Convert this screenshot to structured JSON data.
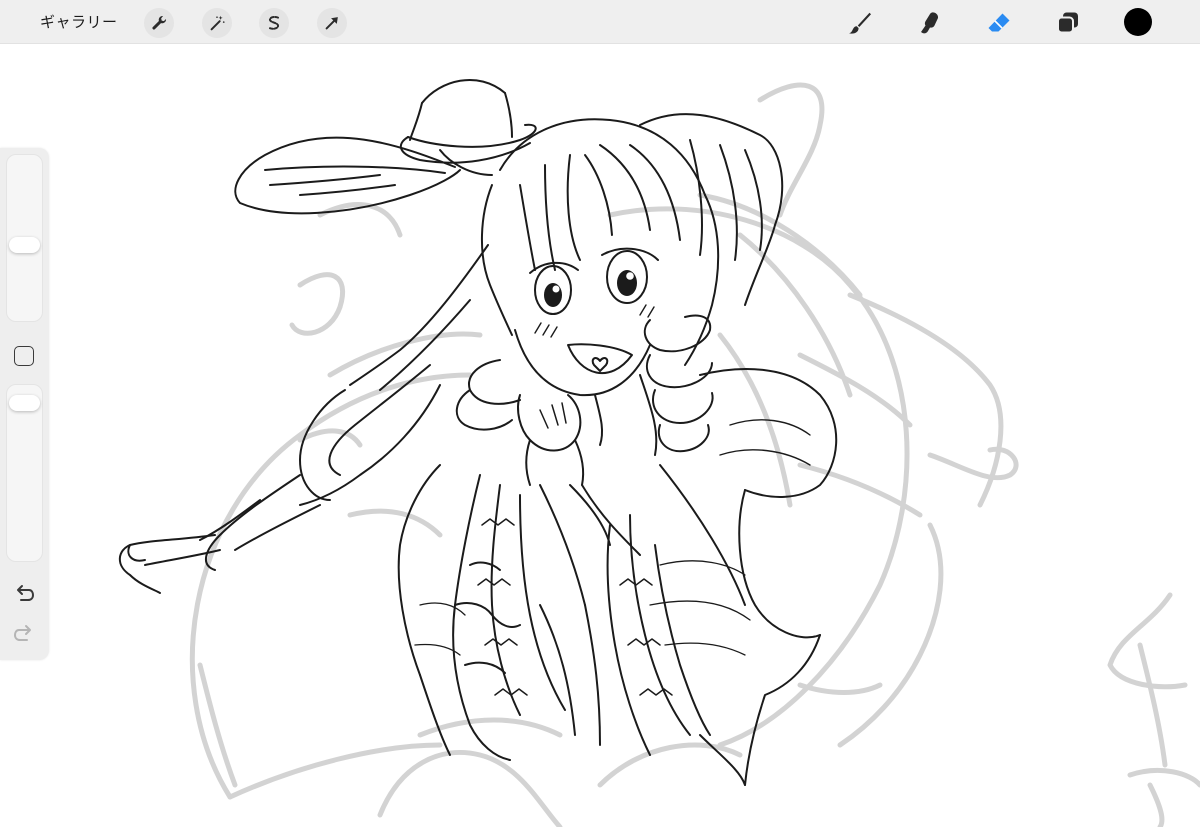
{
  "toolbar": {
    "gallery_label": "ギャラリー",
    "left_tools": [
      {
        "name": "actions",
        "icon": "wrench-icon"
      },
      {
        "name": "adjustments",
        "icon": "magic-wand-icon"
      },
      {
        "name": "selection",
        "icon": "selection-s-icon"
      },
      {
        "name": "transform",
        "icon": "arrow-cursor-icon"
      }
    ],
    "right_tools": [
      {
        "name": "brush",
        "icon": "brush-icon",
        "active": false
      },
      {
        "name": "smudge",
        "icon": "smudge-icon",
        "active": false
      },
      {
        "name": "eraser",
        "icon": "eraser-icon",
        "active": true
      },
      {
        "name": "layers",
        "icon": "layers-icon",
        "active": false
      }
    ],
    "current_color": "#000000"
  },
  "sidebar": {
    "brush_size_level": 0.45,
    "opacity_level": 0.95,
    "modify_icon": "square-icon",
    "undo_icon": "undo-icon",
    "redo_icon": "redo-icon"
  },
  "colors": {
    "toolbar_bg": "#efefef",
    "active_tool": "#2a8bf2",
    "icon": "#2b2b2b",
    "sketch_line": "#1a1a1a",
    "rough_layer": "#d2d2d2"
  }
}
